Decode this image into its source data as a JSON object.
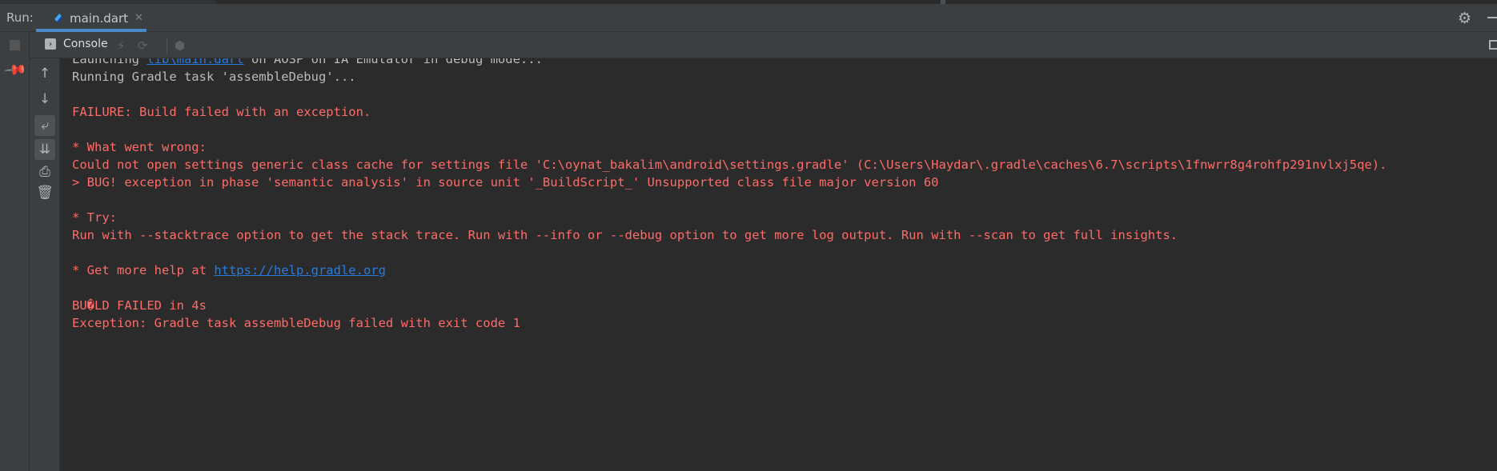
{
  "run_panel": {
    "label": "Run:",
    "tab_label": "main.dart",
    "tab_icon": "dart-icon",
    "settings_icon": "gear-icon"
  },
  "toolbar": {
    "console_label": "Console"
  },
  "side_tools": [
    "stop-icon",
    "pin-icon",
    "up-arrow-icon",
    "down-arrow-icon",
    "soft-wrap-icon",
    "scroll-to-end-icon",
    "print-icon",
    "trash-icon"
  ],
  "console": {
    "launch_prefix": "Launching ",
    "launch_link": "lib\\main.dart",
    "launch_suffix": " on AOSP on IA Emulator in debug mode...",
    "gradle_task": "Running Gradle task 'assembleDebug'...",
    "failure": "FAILURE: Build failed with an exception.",
    "what_wrong": "* What went wrong:",
    "could_not_open": "Could not open settings generic class cache for settings file 'C:\\oynat_bakalim\\android\\settings.gradle' (C:\\Users\\Haydar\\.gradle\\caches\\6.7\\scripts\\1fnwrr8g4rohfp291nvlxj5qe).",
    "bug": "> BUG! exception in phase 'semantic analysis' in source unit '_BuildScript_' Unsupported class file major version 60",
    "try": "* Try:",
    "run_with": "Run with --stacktrace option to get the stack trace. Run with --info or --debug option to get more log output. Run with --scan to get full insights.",
    "help_prefix": "* Get more help at ",
    "help_link": "https://help.gradle.org",
    "build_failed": "BU�LD FAILED in 4s",
    "exception": "Exception: Gradle task assembleDebug failed with exit code 1"
  },
  "colors": {
    "error": "#ff6b68",
    "link": "#287bde",
    "normal": "#bbbbbb",
    "accent": "#4a88c7"
  }
}
